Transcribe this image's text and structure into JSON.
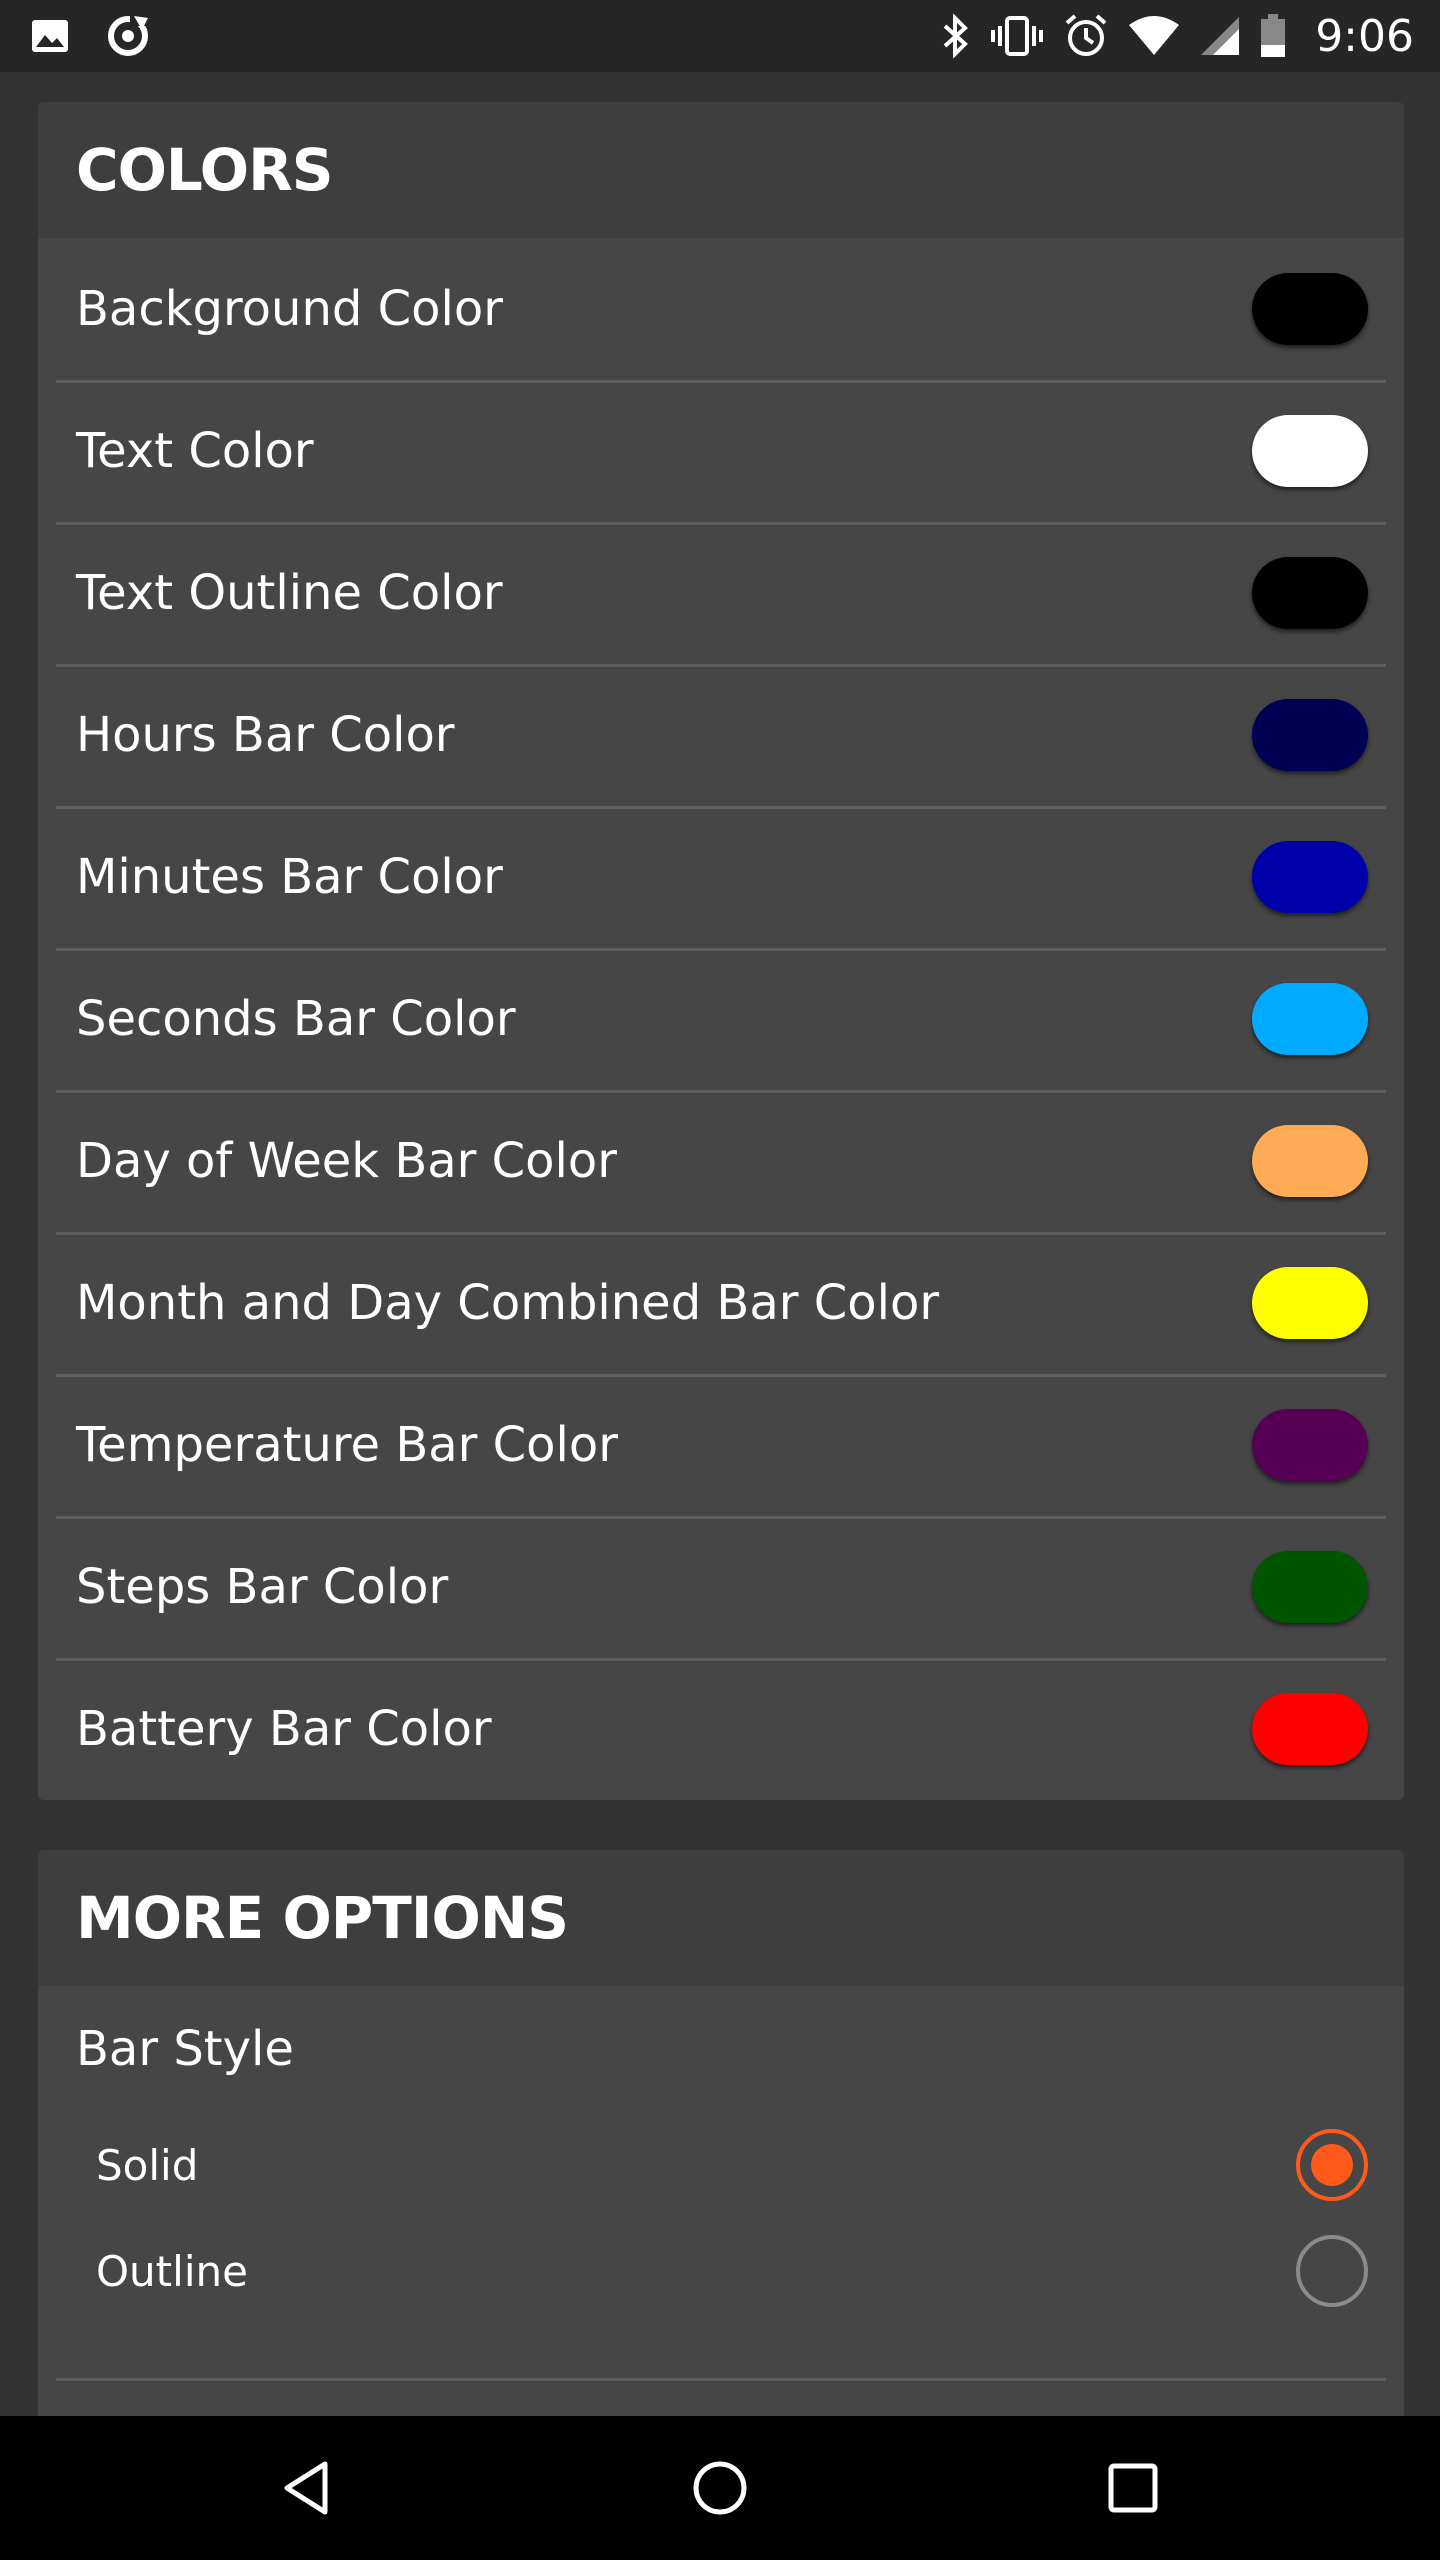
{
  "status_bar": {
    "time": "9:06",
    "left_icons": [
      "image-icon",
      "sync-icon"
    ],
    "right_icons": [
      "bluetooth-icon",
      "vibrate-icon",
      "alarm-icon",
      "wifi-icon",
      "signal-icon",
      "battery-icon"
    ]
  },
  "colors_section": {
    "title": "COLORS",
    "items": [
      {
        "label": "Background Color",
        "color": "#000000"
      },
      {
        "label": "Text Color",
        "color": "#ffffff"
      },
      {
        "label": "Text Outline Color",
        "color": "#000000"
      },
      {
        "label": "Hours Bar Color",
        "color": "#000055"
      },
      {
        "label": "Minutes Bar Color",
        "color": "#0000aa"
      },
      {
        "label": "Seconds Bar Color",
        "color": "#00aaff"
      },
      {
        "label": "Day of Week Bar Color",
        "color": "#ffaa55"
      },
      {
        "label": "Month and Day Combined Bar Color",
        "color": "#ffff00"
      },
      {
        "label": "Temperature Bar Color",
        "color": "#550055"
      },
      {
        "label": "Steps Bar Color",
        "color": "#005500"
      },
      {
        "label": "Battery Bar Color",
        "color": "#ff0000"
      }
    ]
  },
  "more_options": {
    "title": "MORE OPTIONS",
    "bar_style": {
      "label": "Bar Style",
      "options": [
        {
          "label": "Solid",
          "selected": true
        },
        {
          "label": "Outline",
          "selected": false
        }
      ]
    }
  },
  "accent_color": "#ff5a1a",
  "nav_bar": {
    "buttons": [
      "back-icon",
      "home-icon",
      "recents-icon"
    ]
  }
}
